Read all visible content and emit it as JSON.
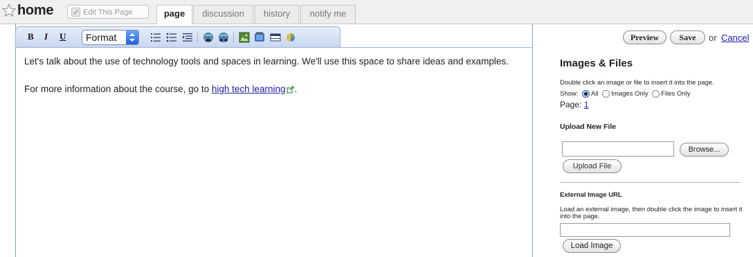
{
  "page": {
    "title": "home",
    "edit_button": "Edit This Page",
    "tabs": [
      {
        "label": "page",
        "active": true
      },
      {
        "label": "discussion",
        "active": false
      },
      {
        "label": "history",
        "active": false
      },
      {
        "label": "notify me",
        "active": false
      }
    ]
  },
  "toolbar": {
    "bold": "B",
    "italic": "I",
    "underline": "U",
    "format_select": "Format",
    "icons": [
      "numbered-list-icon",
      "bullet-list-icon",
      "indent-list-icon",
      "link-icon",
      "unlink-icon",
      "image-icon",
      "media-icon",
      "table-icon",
      "widget-icon"
    ]
  },
  "content": {
    "paragraph1": "Let's talk about the use of technology tools and spaces in learning. We'll use this space to share ideas and examples.",
    "paragraph2_prefix": "For more information about the course, go to ",
    "link_text": "high tech learning",
    "paragraph2_suffix": "."
  },
  "actions": {
    "preview": "Preview",
    "save": "Save",
    "or": "or",
    "cancel": "Cancel"
  },
  "sidebar": {
    "heading": "Images & Files",
    "hint": "Double click an image or file to insert it into the page.",
    "show_label": "Show:",
    "filters": [
      {
        "label": "All",
        "selected": true
      },
      {
        "label": "Images Only",
        "selected": false
      },
      {
        "label": "Files Only",
        "selected": false
      }
    ],
    "page_label": "Page:",
    "page_number": "1",
    "upload_heading": "Upload New File",
    "file_input_value": "",
    "browse_button": "Browse...",
    "upload_button": "Upload File",
    "external_heading": "External Image URL",
    "external_hint": "Load an external image, then double click the image to insert it into the page.",
    "url_input_value": "",
    "load_button": "Load Image"
  },
  "colors": {
    "link": "#1a1aa6",
    "toolbar_bg": "#c9d7f0",
    "select_arrow": "#1e62d8"
  }
}
